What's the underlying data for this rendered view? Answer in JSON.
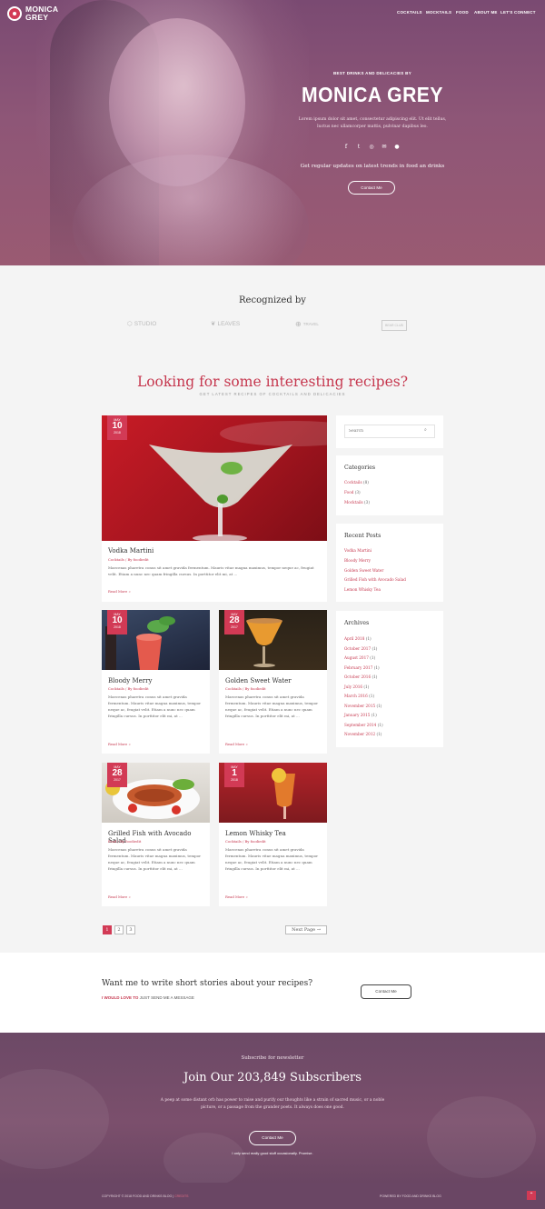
{
  "brand": {
    "line1": "MONICA",
    "line2": "GREY"
  },
  "nav": [
    "COCKTAILS",
    "MOCKTAILS",
    "FOOD",
    "ABOUT ME",
    "LET'S CONNECT"
  ],
  "hero": {
    "kicker": "BEST DRINKS AND DELICACIES BY",
    "title": "MONICA GREY",
    "description": "Lorem ipsum dolor sit amet, consectetur adipiscing elit. Ut elit tellus, luctus nec ullamcorper mattis, pulvinar dapibus leo.",
    "social_icons": [
      "facebook-icon",
      "twitter-icon",
      "instagram-icon",
      "email-icon",
      "user-icon"
    ],
    "updates": "Get regular updates on latest trends in food an drinks",
    "button": "Contact Me"
  },
  "recognized": {
    "title": "Recognized by",
    "logos": [
      "STUDIO",
      "LEAVES",
      "TRAVEL",
      "BEAR CLUB"
    ]
  },
  "recipes": {
    "title": "Looking for some interesting recipes?",
    "subtitle": "GET LATEST RECIPES OF COCKTAILS AND DELICACIES"
  },
  "posts": [
    {
      "title": "Vodka Martini",
      "meta": "Cocktails / By foodiedit",
      "excerpt": "Maecenas pharetra conus sit amet gravida fermentum. Mauris vitae magna maximus, tempor neque ac, feugiat velit. Etiam a nunc nec quam fringilla cursus. In porttitor elit mi, at ...",
      "read": "Read More »",
      "month": "MAY",
      "day": "10",
      "year": "2018"
    },
    {
      "title": "Bloody Merry",
      "meta": "Cocktails / By foodiedit",
      "excerpt": "Maecenas pharetra conus sit amet gravida fermentum. Mauris vitae magna maximus, tempor neque ac, feugiat velit. Etiam a nunc nec quam fringilla cursus. In porttitor elit mi, at ...",
      "read": "Read More »",
      "month": "MAY",
      "day": "10",
      "year": "2018"
    },
    {
      "title": "Golden Sweet Water",
      "meta": "Cocktails / By foodiedit",
      "excerpt": "Maecenas pharetra conus sit amet gravida fermentum. Mauris vitae magna maximus, tempor neque ac, feugiat velit. Etiam a nunc nec quam fringilla cursus. In porttitor elit mi, at ...",
      "read": "Read More »",
      "month": "MAY",
      "day": "28",
      "year": "2017"
    },
    {
      "title": "Grilled Fish with Avocado Salad",
      "meta": "Food / By foodiedit",
      "excerpt": "Maecenas pharetra conus sit amet gravida fermentum. Mauris vitae magna maximus, tempor neque ac, feugiat velit. Etiam a nunc nec quam fringilla cursus. In porttitor elit mi, at ...",
      "read": "Read More »",
      "month": "MAY",
      "day": "28",
      "year": "2017"
    },
    {
      "title": "Lemon Whisky Tea",
      "meta": "Cocktails / By foodiedit",
      "excerpt": "Maecenas pharetra conus sit amet gravida fermentum. Mauris vitae magna maximus, tempor neque ac, feugiat velit. Etiam a nunc nec quam fringilla cursus. In porttitor elit mi, at ...",
      "read": "Read More »",
      "month": "MAY",
      "day": "1",
      "year": "2018"
    }
  ],
  "sidebar": {
    "search_placeholder": "Search",
    "categories_title": "Categories",
    "categories": [
      {
        "name": "Cocktails",
        "count": "(8)"
      },
      {
        "name": "Food",
        "count": "(3)"
      },
      {
        "name": "Mocktails",
        "count": "(3)"
      }
    ],
    "recent_title": "Recent Posts",
    "recent": [
      "Vodka Martini",
      "Bloody Merry",
      "Golden Sweet Water",
      "Grilled Fish with Avocado Salad",
      "Lemon Whisky Tea"
    ],
    "archives_title": "Archives",
    "archives": [
      {
        "name": "April 2018",
        "count": "(1)"
      },
      {
        "name": "October 2017",
        "count": "(1)"
      },
      {
        "name": "August 2017",
        "count": "(1)"
      },
      {
        "name": "February 2017",
        "count": "(1)"
      },
      {
        "name": "October 2016",
        "count": "(1)"
      },
      {
        "name": "July 2016",
        "count": "(1)"
      },
      {
        "name": "March 2016",
        "count": "(1)"
      },
      {
        "name": "November 2015",
        "count": "(1)"
      },
      {
        "name": "January 2015",
        "count": "(1)"
      },
      {
        "name": "September 2014",
        "count": "(1)"
      },
      {
        "name": "November 2012",
        "count": "(1)"
      }
    ]
  },
  "pagination": {
    "pages": [
      "1",
      "2",
      "3"
    ],
    "next": "Next Page →"
  },
  "cta": {
    "title": "Want me to write short stories about your recipes?",
    "lead": "I WOULD LOVE TO",
    "rest": " JUST SEND ME A MESSAGE",
    "button": "Contact Me"
  },
  "newsletter": {
    "kicker": "Subscribe for newsletter",
    "title": "Join Our 203,849 Subscribers",
    "text": "A peep at some distant orb has power to raise and purify our thoughts like a strain of sacred music, or a noble picture, or a passage from the grander poets. It always does one good.",
    "button": "Contact Me",
    "note": "I only send really good stuff occasionally. Promise."
  },
  "footer": {
    "left": "COPYRIGHT © 2018 FOOD AND DRINKS BLOG |",
    "left_link": "CREDITS",
    "right": "POWERED BY FOOD AND DRINKS BLOG"
  },
  "colors": {
    "accent": "#d23a55",
    "hero": "#8e5677"
  }
}
